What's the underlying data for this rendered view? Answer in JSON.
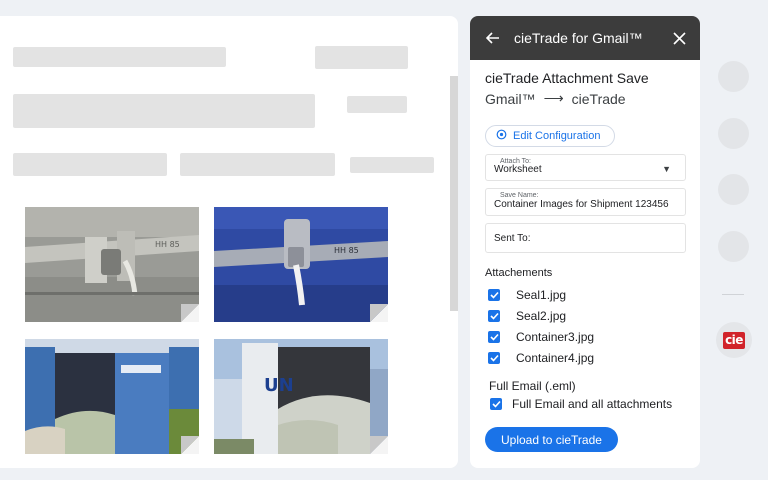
{
  "panel": {
    "title": "cieTrade for Gmail™",
    "heading": "cieTrade Attachment Save",
    "flow_from": "Gmail™",
    "flow_arrow": "⟶",
    "flow_to": "cieTrade",
    "edit_config_label": "Edit Configuration",
    "attach_to": {
      "label": "Attach To:",
      "value": "Worksheet"
    },
    "save_name": {
      "label": "Save Name:",
      "value": "Container Images for Shipment 123456"
    },
    "sent_to": {
      "label": "Sent To:"
    },
    "attachments_label": "Attachements",
    "attachments": [
      {
        "name": "Seal1.jpg",
        "checked": true
      },
      {
        "name": "Seal2.jpg",
        "checked": true
      },
      {
        "name": "Container3.jpg",
        "checked": true
      },
      {
        "name": "Container4.jpg",
        "checked": true
      }
    ],
    "full_email_label": "Full Email (.eml)",
    "full_email_option": {
      "label": "Full Email and all attachments",
      "checked": true
    },
    "upload_label": "Upload to cieTrade"
  },
  "rail": {
    "logo_text": "cie"
  },
  "icons": {
    "back": "arrow-left-icon",
    "close": "close-icon",
    "settings": "gear-icon",
    "dropdown": "caret-down-icon",
    "checkbox": "checkmark-icon"
  },
  "colors": {
    "accent": "#1a73e8",
    "header_bg": "#3c3c3c",
    "brand_red": "#d1232a",
    "container_blue": "#2f4aa3"
  }
}
